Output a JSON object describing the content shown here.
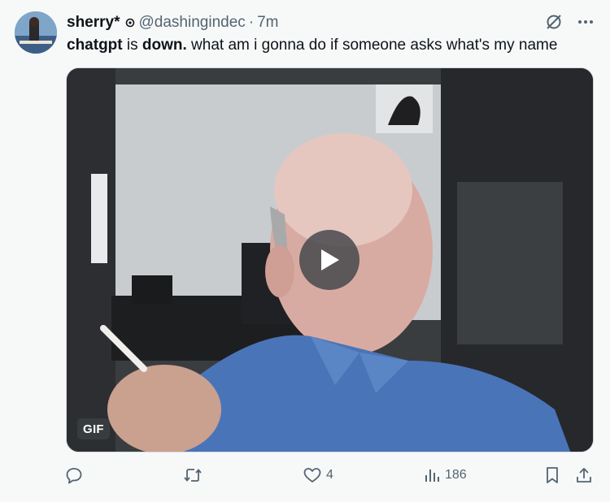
{
  "tweet": {
    "display_name": "sherry*",
    "handle": "@dashingindec",
    "separator": "·",
    "time": "7m",
    "text": {
      "part1": "chatgpt",
      "part2": " is ",
      "part3": "down.",
      "part4": " what am i gonna do if someone asks what's my name"
    },
    "media": {
      "badge": "GIF"
    }
  },
  "actions": {
    "reply_count": "",
    "retweet_count": "",
    "like_count": "4",
    "view_count": "186"
  },
  "icons": {
    "verified": "circle-badge-icon",
    "grok": "slash-circle-icon",
    "more": "more-icon",
    "reply": "reply-icon",
    "retweet": "retweet-icon",
    "like": "heart-icon",
    "views": "bar-chart-icon",
    "bookmark": "bookmark-icon",
    "share": "share-icon",
    "play": "play-icon"
  },
  "colors": {
    "background": "#f7f9f9",
    "text": "#0f1419",
    "secondary": "#536471"
  }
}
